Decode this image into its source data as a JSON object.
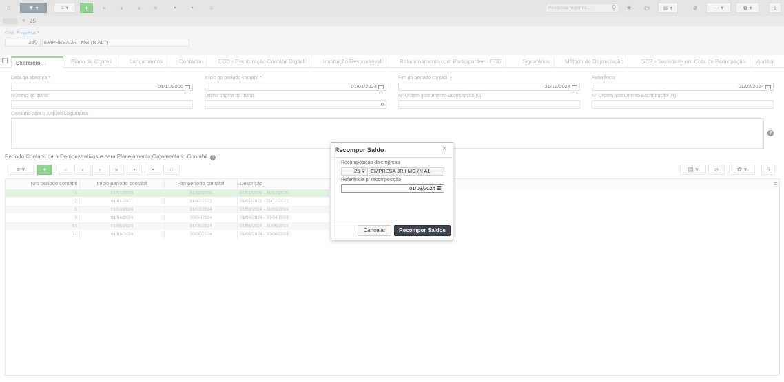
{
  "toolbar": {
    "search_placeholder": "Pesquisar registros...",
    "count": "1"
  },
  "breadcrumb": {
    "record": "25"
  },
  "header": {
    "empresa_label": "Cód. Empresa",
    "empresa_code": "25",
    "empresa_name": "EMPRESA JR I MG (N ALT)"
  },
  "tabs": [
    "Exercício",
    "Plano de Contas",
    "Lançamentos",
    "Contador",
    "ECD - Escrituração Contábil Digital",
    "Instituição Responsável",
    "Relacionamento com Participantes - ECD",
    "Signatários",
    "Método de Depreciação",
    "SCP - Sociedade em Cota de Participação",
    "Auditor"
  ],
  "form": {
    "data_abertura_label": "Data da abertura",
    "data_abertura": "01/11/2006",
    "inicio_label": "Início do período contábil",
    "inicio": "01/01/2024",
    "fim_label": "Fim do período contábil",
    "fim": "31/12/2024",
    "referencia_label": "Referência",
    "referencia": "01/03/2024",
    "numero_diario_label": "Número do diário",
    "numero_diario": "",
    "ultima_pagina_label": "Última página do diário",
    "ultima_pagina": "0",
    "ordem_g_label": "Nº Ordem Instrumento Escrituração (G)",
    "ordem_g": "",
    "ordem_r_label": "Nº Ordem Instrumento Escrituração (R)",
    "ordem_r": "",
    "caminho_label": "Caminho para o Arquivo Logomarca",
    "caminho": ""
  },
  "section": {
    "title": "Período Contábil para Demonstrativos e para Planejamento Orçamentário Contábil.",
    "page_size": "6"
  },
  "grid": {
    "columns": [
      "Nro período contábil",
      "Início período contábil",
      "Fim período contábil",
      "Descrição"
    ],
    "rows": [
      {
        "nro": "1",
        "inicio": "01/01/2020",
        "fim": "31/12/2020",
        "desc": "01/01/2020 - 31/12/2020"
      },
      {
        "nro": "2",
        "inicio": "01/01/2021",
        "fim": "31/12/2021",
        "desc": "01/01/2021 - 31/12/2021"
      },
      {
        "nro": "8",
        "inicio": "01/03/2024",
        "fim": "31/03/2024",
        "desc": "01/03/2024 - 31/03/2024"
      },
      {
        "nro": "9",
        "inicio": "01/04/2024",
        "fim": "30/04/2024",
        "desc": "01/04/2024 - 30/04/2024"
      },
      {
        "nro": "10",
        "inicio": "01/05/2024",
        "fim": "31/05/2024",
        "desc": "01/05/2024 - 31/05/2024"
      },
      {
        "nro": "11",
        "inicio": "01/06/2024",
        "fim": "30/06/2024",
        "desc": "01/06/2024 - 30/06/2024"
      }
    ]
  },
  "dialog": {
    "title": "Recompor Saldo",
    "empresa_label": "Recomposição da empresa",
    "empresa_code": "25",
    "empresa_name": "EMPRESA JR I MG (N AL",
    "ref_label": "Referência p/ recomposição",
    "ref_value": "01/03/2024",
    "cancel": "Cancelar",
    "confirm": "Recompor Saldos"
  },
  "colors": {
    "accent": "#5cb85c",
    "dark_button": "#3d4450",
    "required": "#e05050"
  }
}
